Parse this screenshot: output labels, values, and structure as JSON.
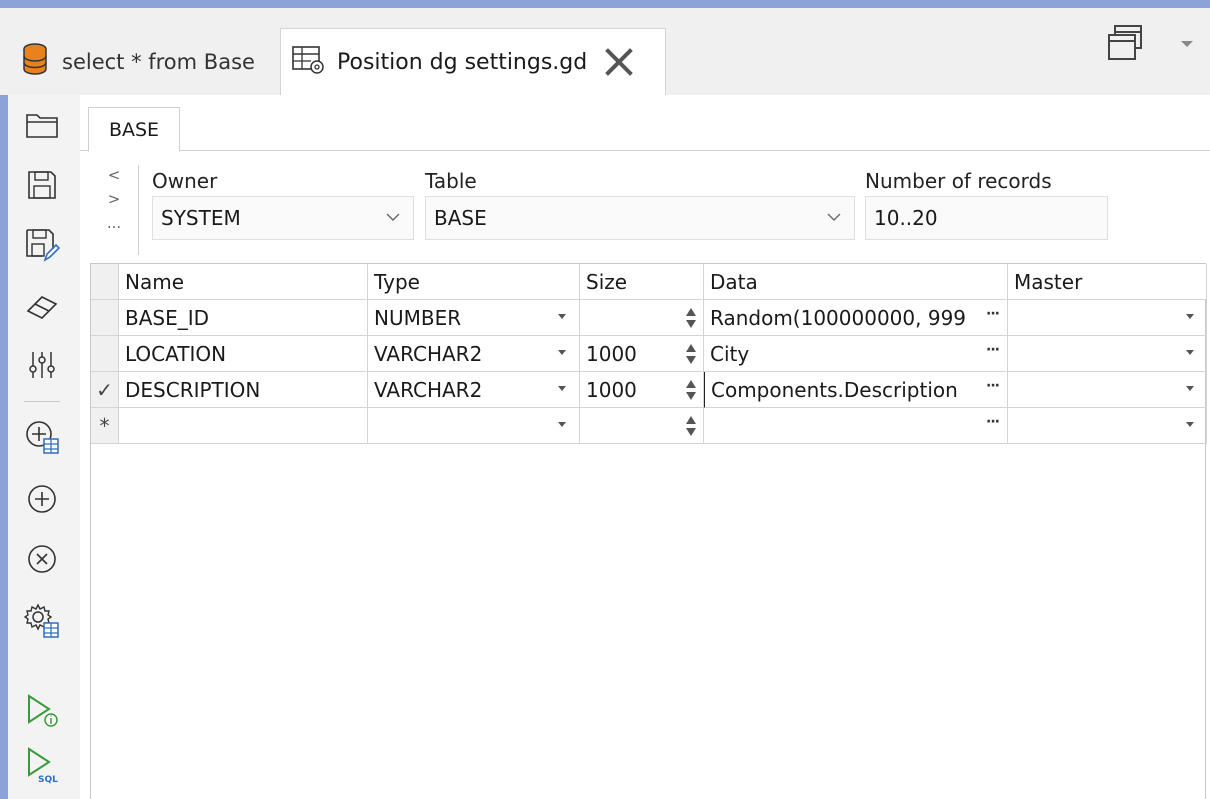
{
  "tabs": [
    {
      "label": "select * from Base"
    },
    {
      "label": "Position dg settings.gd"
    }
  ],
  "inner_tab": {
    "label": "BASE"
  },
  "nav": {
    "prev": "<",
    "next": ">",
    "more": "..."
  },
  "owner": {
    "label": "Owner",
    "value": "SYSTEM"
  },
  "table": {
    "label": "Table",
    "value": "BASE"
  },
  "records": {
    "label": "Number of records",
    "value": "10..20"
  },
  "grid": {
    "columns": [
      "Name",
      "Type",
      "Size",
      "Data",
      "Master"
    ],
    "rows": [
      {
        "marker": "",
        "name": "BASE_ID",
        "type": "NUMBER",
        "size": "",
        "data": "Random(100000000, 999",
        "master": ""
      },
      {
        "marker": "",
        "name": "LOCATION",
        "type": "VARCHAR2",
        "size": "1000",
        "data": "City",
        "master": ""
      },
      {
        "marker": "✓",
        "name": "DESCRIPTION",
        "type": "VARCHAR2",
        "size": "1000",
        "data": "Components.Description",
        "master": ""
      },
      {
        "marker": "*",
        "name": "",
        "type": "",
        "size": "",
        "data": "",
        "master": ""
      }
    ],
    "ellipsis": "···"
  },
  "icons": {
    "database": "database-icon",
    "grid_settings": "table-settings-icon",
    "close": "close-icon",
    "windows": "window-list-icon"
  },
  "colors": {
    "frame": "#8ba3d6",
    "db_orange": "#e8821e",
    "green": "#3a9a3a",
    "blue": "#2f6fbf"
  }
}
